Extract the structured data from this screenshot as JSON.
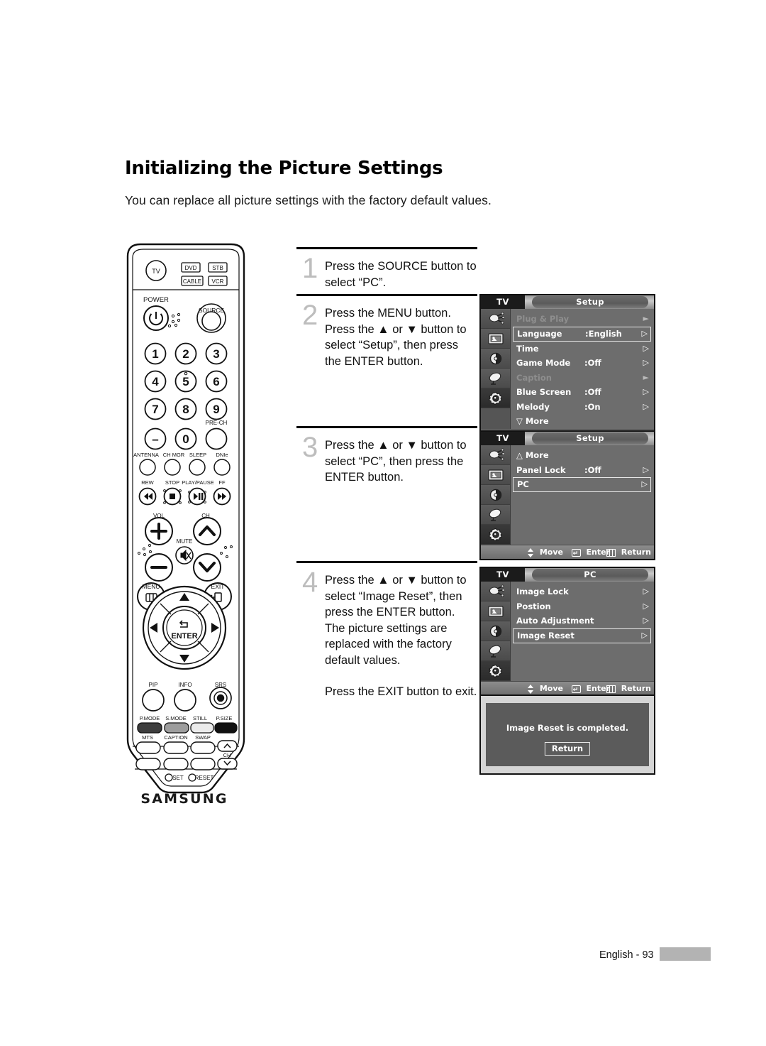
{
  "page": {
    "title": "Initializing the Picture Settings",
    "subtitle": "You can replace all picture settings with the factory default values.",
    "footer_text": "English - 93"
  },
  "steps": [
    {
      "number": "1",
      "lines": [
        "Press the SOURCE button to select “PC”."
      ]
    },
    {
      "number": "2",
      "lines": [
        "Press the MENU button.",
        "Press the ▲ or ▼ button to",
        "select “Setup”, then press",
        "the ENTER button."
      ]
    },
    {
      "number": "3",
      "lines": [
        "Press the ▲ or ▼ button to",
        "select “PC”, then press the",
        "ENTER button."
      ]
    },
    {
      "number": "4",
      "lines": [
        "Press the ▲ or ▼ button to",
        "select “Image Reset”, then",
        "press the ENTER button.",
        "The picture settings are",
        "replaced with the factory",
        "default values."
      ],
      "extra_line": "Press the EXIT button to exit."
    }
  ],
  "osd_common": {
    "source_label": "TV",
    "hints": {
      "move": "Move",
      "enter": "Enter",
      "return": "Return"
    },
    "rail_icons": [
      "input-source-icon",
      "picture-icon",
      "sound-icon",
      "channel-dish-icon",
      "setup-gear-icon"
    ]
  },
  "osd_menus": [
    {
      "id": "setup-page-1",
      "tab_label": "Setup",
      "selected_rail_index": 4,
      "rows": [
        {
          "label": "Plug & Play",
          "value": "",
          "arrow": "filled",
          "state": "dim",
          "selected": false
        },
        {
          "label": "Language",
          "value": ":English",
          "arrow": "outline",
          "state": "normal",
          "selected": true
        },
        {
          "label": "Time",
          "value": "",
          "arrow": "outline",
          "state": "normal",
          "selected": false
        },
        {
          "label": "Game Mode",
          "value": ":Off",
          "arrow": "outline",
          "state": "normal",
          "selected": false
        },
        {
          "label": "Caption",
          "value": "",
          "arrow": "filled",
          "state": "dim",
          "selected": false
        },
        {
          "label": "Blue Screen",
          "value": ":Off",
          "arrow": "outline",
          "state": "normal",
          "selected": false
        },
        {
          "label": "Melody",
          "value": ":On",
          "arrow": "outline",
          "state": "normal",
          "selected": false
        },
        {
          "label": "▽ More",
          "value": "",
          "arrow": "none",
          "state": "normal",
          "selected": false
        }
      ]
    },
    {
      "id": "setup-page-2",
      "tab_label": "Setup",
      "selected_rail_index": 4,
      "rows": [
        {
          "label": "△ More",
          "value": "",
          "arrow": "none",
          "state": "normal",
          "selected": false
        },
        {
          "label": "Panel Lock",
          "value": ":Off",
          "arrow": "outline",
          "state": "normal",
          "selected": false
        },
        {
          "label": "PC",
          "value": "",
          "arrow": "outline",
          "state": "normal",
          "selected": true
        }
      ]
    },
    {
      "id": "pc-page",
      "tab_label": "PC",
      "selected_rail_index": 4,
      "rows": [
        {
          "label": "Image Lock",
          "value": "",
          "arrow": "outline",
          "state": "normal",
          "selected": false
        },
        {
          "label": "Postion",
          "value": "",
          "arrow": "outline",
          "state": "normal",
          "selected": false
        },
        {
          "label": "Auto Adjustment",
          "value": "",
          "arrow": "outline",
          "state": "normal",
          "selected": false
        },
        {
          "label": "Image Reset",
          "value": "",
          "arrow": "outline",
          "state": "normal",
          "selected": true
        }
      ]
    }
  ],
  "osd_dialog": {
    "message": "Image Reset is completed.",
    "button_label": "Return"
  },
  "remote": {
    "brand": "SAMSUNG",
    "device_buttons": [
      "TV",
      "DVD",
      "STB",
      "CABLE",
      "VCR"
    ],
    "power_label": "POWER",
    "source_label": "SOURCE",
    "numbers": [
      "1",
      "2",
      "3",
      "4",
      "5",
      "6",
      "7",
      "8",
      "9",
      "–",
      "0",
      ""
    ],
    "pre_ch_label": "PRE-CH",
    "function_row_1": [
      "ANTENNA",
      "CH MGR",
      "SLEEP",
      "DNIe"
    ],
    "transport_row": [
      "REW",
      "STOP",
      "PLAY/PAUSE",
      "FF"
    ],
    "vol_label": "VOL",
    "ch_label": "CH",
    "mute_label": "MUTE",
    "menu_label": "MENU",
    "exit_label": "EXIT",
    "enter_label": "ENTER",
    "feature_row": [
      "PIP",
      "INFO",
      "SRS"
    ],
    "color_row": [
      "P.MODE",
      "S.MODE",
      "STILL",
      "P.SIZE"
    ],
    "bottom_row": [
      "MTS",
      "CAPTION",
      "SWAP"
    ],
    "ch_updown_label": "CH",
    "set_label": "SET",
    "reset_label": "RESET"
  },
  "colors": {
    "osd_panel": "#6d6d6d",
    "osd_rail": "#555555",
    "osd_selected_border": "#e8e8e8",
    "footer_bar": "#b3b3b3",
    "step_number": "#bdbdbd"
  }
}
